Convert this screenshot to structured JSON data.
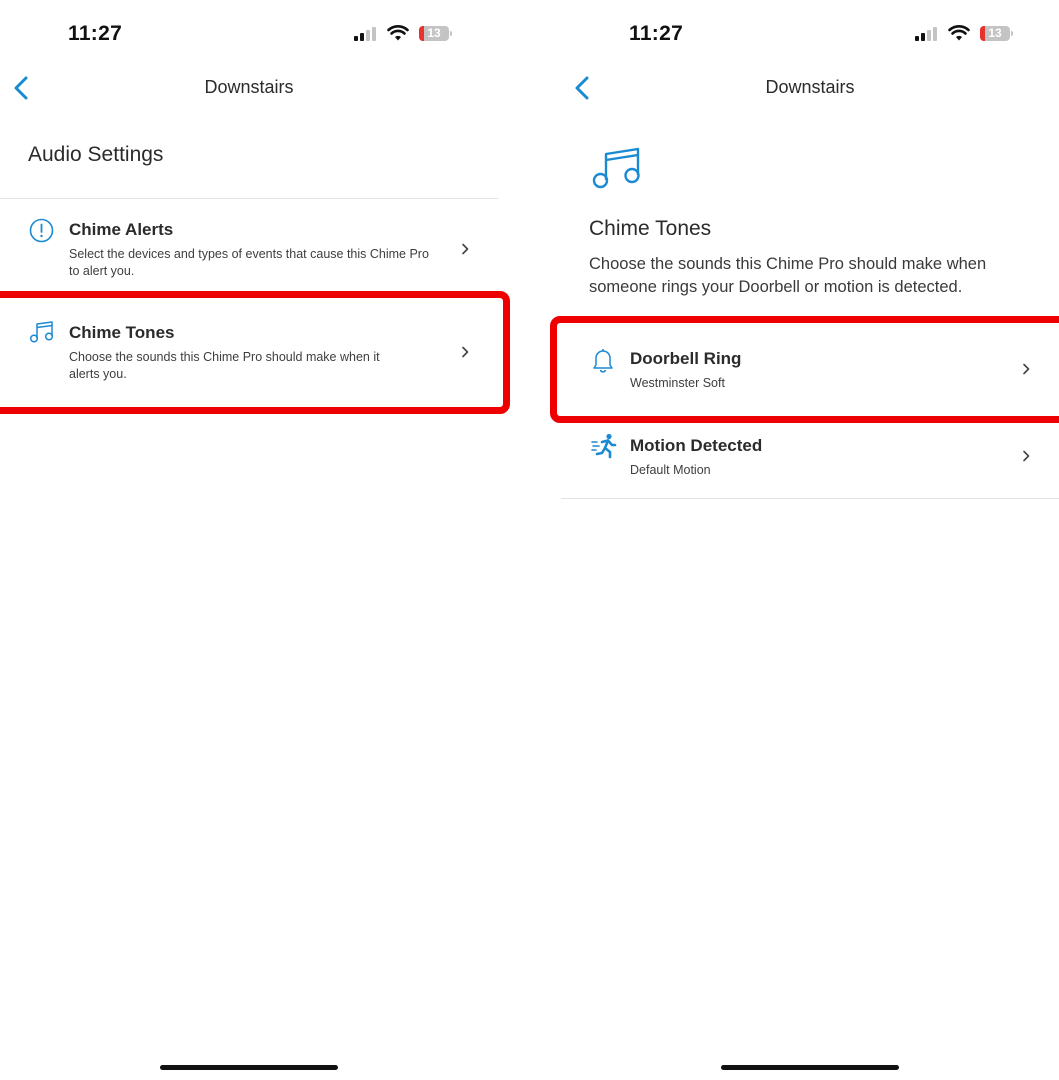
{
  "left": {
    "status": {
      "time": "11:27",
      "battery": "13"
    },
    "nav": {
      "title": "Downstairs"
    },
    "section_title": "Audio Settings",
    "items": [
      {
        "icon": "info-circle-icon",
        "title": "Chime Alerts",
        "subtitle_line1": "Select the devices and types of events that cause this Chime Pro",
        "subtitle_line2": "to alert you."
      },
      {
        "icon": "music-note-icon",
        "title": "Chime Tones",
        "subtitle_line1": "Choose the sounds this Chime Pro should make when it",
        "subtitle_line2": "alerts you."
      }
    ]
  },
  "right": {
    "status": {
      "time": "11:27",
      "battery": "13"
    },
    "nav": {
      "title": "Downstairs"
    },
    "header_icon": "music-note-icon",
    "title": "Chime Tones",
    "description_line1": "Choose the sounds this Chime Pro should make when",
    "description_line2": "someone rings your Doorbell or motion is detected.",
    "items": [
      {
        "icon": "bell-icon",
        "title": "Doorbell Ring",
        "value": "Westminster Soft"
      },
      {
        "icon": "motion-runner-icon",
        "title": "Motion Detected",
        "value": "Default Motion"
      }
    ]
  },
  "colors": {
    "accent": "#1a8ad3",
    "highlight": "#ee0000"
  }
}
